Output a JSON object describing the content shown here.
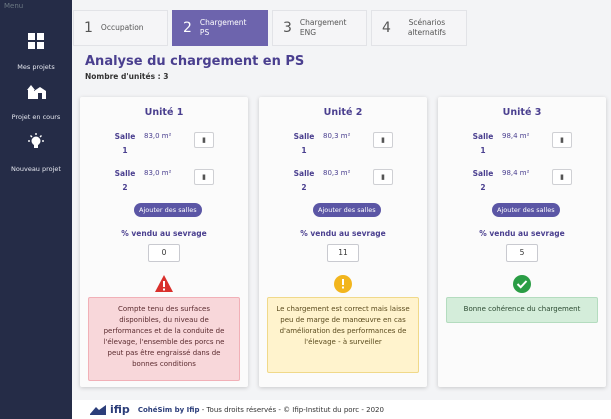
{
  "sidebar": {
    "top_text": "Menu",
    "items": [
      {
        "label": "Mes projets",
        "icon": "grid-icon"
      },
      {
        "label": "Projet en cours",
        "icon": "farm-icon"
      },
      {
        "label": "Nouveau projet",
        "icon": "lightbulb-icon"
      }
    ]
  },
  "tabs": [
    {
      "num": "1",
      "label": "Occupation",
      "active": false
    },
    {
      "num": "2",
      "label": "Chargement PS",
      "active": true
    },
    {
      "num": "3",
      "label": "Chargement ENG",
      "active": false
    },
    {
      "num": "4",
      "label": "Scénarios alternatifs",
      "active": false
    }
  ],
  "page": {
    "title": "Analyse du chargement en PS",
    "units_count": "Nombre d'unités : 3"
  },
  "units": [
    {
      "title": "Unité 1",
      "salles": [
        {
          "label": "Salle 1",
          "value": "83,0 m²"
        },
        {
          "label": "Salle 2",
          "value": "83,0 m²"
        }
      ],
      "add_label": "Ajouter des salles",
      "pct_label": "% vendu au sevrage",
      "pct_value": "0",
      "status": "danger",
      "status_icon": "warning-triangle-icon",
      "message": "Compte tenu des surfaces disponibles, du niveau de performances et de la conduite de l'élevage, l'ensemble des porcs ne peut pas être engraissé dans de bonnes conditions"
    },
    {
      "title": "Unité 2",
      "salles": [
        {
          "label": "Salle 1",
          "value": "80,3 m²"
        },
        {
          "label": "Salle 2",
          "value": "80,3 m²"
        }
      ],
      "add_label": "Ajouter des salles",
      "pct_label": "% vendu au sevrage",
      "pct_value": "11",
      "status": "warning",
      "status_icon": "exclamation-circle-icon",
      "message": "Le chargement est correct mais laisse peu de marge de manœuvre en cas d'amélioration des performances de l'élevage - à surveiller"
    },
    {
      "title": "Unité 3",
      "salles": [
        {
          "label": "Salle 1",
          "value": "98,4 m²"
        },
        {
          "label": "Salle 2",
          "value": "98,4 m²"
        }
      ],
      "add_label": "Ajouter des salles",
      "pct_label": "% vendu au sevrage",
      "pct_value": "5",
      "status": "success",
      "status_icon": "check-circle-icon",
      "message": "Bonne cohérence du chargement"
    }
  ],
  "footer": {
    "logo": "ifip",
    "brand": "CohéSim by Ifip",
    "text": " - Tous droits réservés - © Ifip-Institut du porc - 2020"
  },
  "colors": {
    "sidebar": "#252c47",
    "accent": "#6d64ad",
    "title": "#4a3f8f",
    "danger": "#d9302c",
    "warning": "#f2b51d",
    "success": "#2a9d45",
    "swoosh": "#1a9fe0"
  }
}
